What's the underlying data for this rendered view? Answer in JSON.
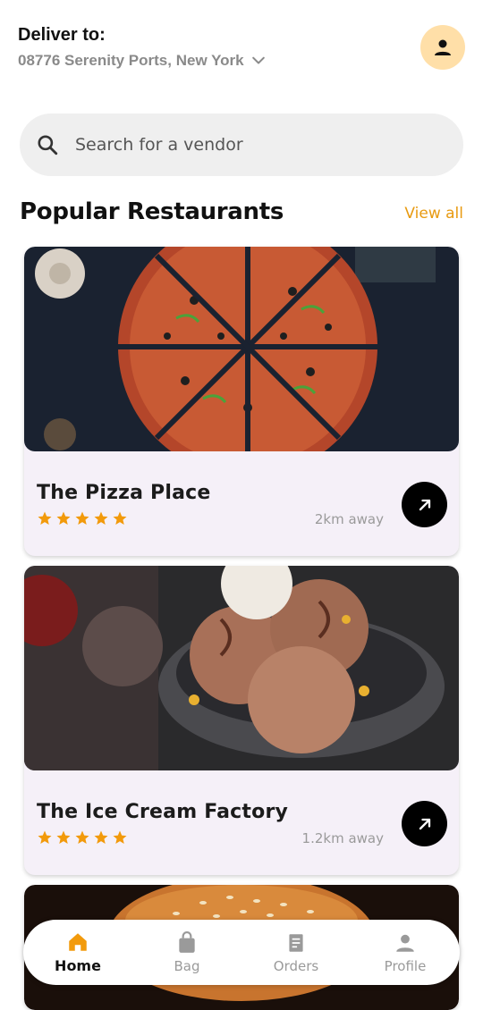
{
  "header": {
    "deliver_label": "Deliver to:",
    "address": "08776 Serenity Ports, New York",
    "icons": {
      "chevron": "chevron-down-icon",
      "avatar": "person-icon"
    }
  },
  "search": {
    "placeholder": "Search for a vendor",
    "icon": "search-icon"
  },
  "section": {
    "title": "Popular Restaurants",
    "view_all": "View all"
  },
  "restaurants": [
    {
      "name": "The Pizza Place",
      "rating": 5,
      "distance": "2km away",
      "image": "pizza-photo"
    },
    {
      "name": "The Ice Cream Factory",
      "rating": 5,
      "distance": "1.2km away",
      "image": "ice-cream-photo"
    },
    {
      "name": "",
      "image": "burger-photo"
    }
  ],
  "nav": {
    "items": [
      {
        "label": "Home",
        "icon": "home-icon",
        "active": true
      },
      {
        "label": "Bag",
        "icon": "bag-icon",
        "active": false
      },
      {
        "label": "Orders",
        "icon": "orders-icon",
        "active": false
      },
      {
        "label": "Profile",
        "icon": "profile-icon",
        "active": false
      }
    ]
  },
  "colors": {
    "accent": "#e89a10",
    "star": "#f29a0b",
    "avatar_bg": "#ffdfa8",
    "card_bg": "#f5f0f8",
    "nav_active": "#f29a0b"
  }
}
